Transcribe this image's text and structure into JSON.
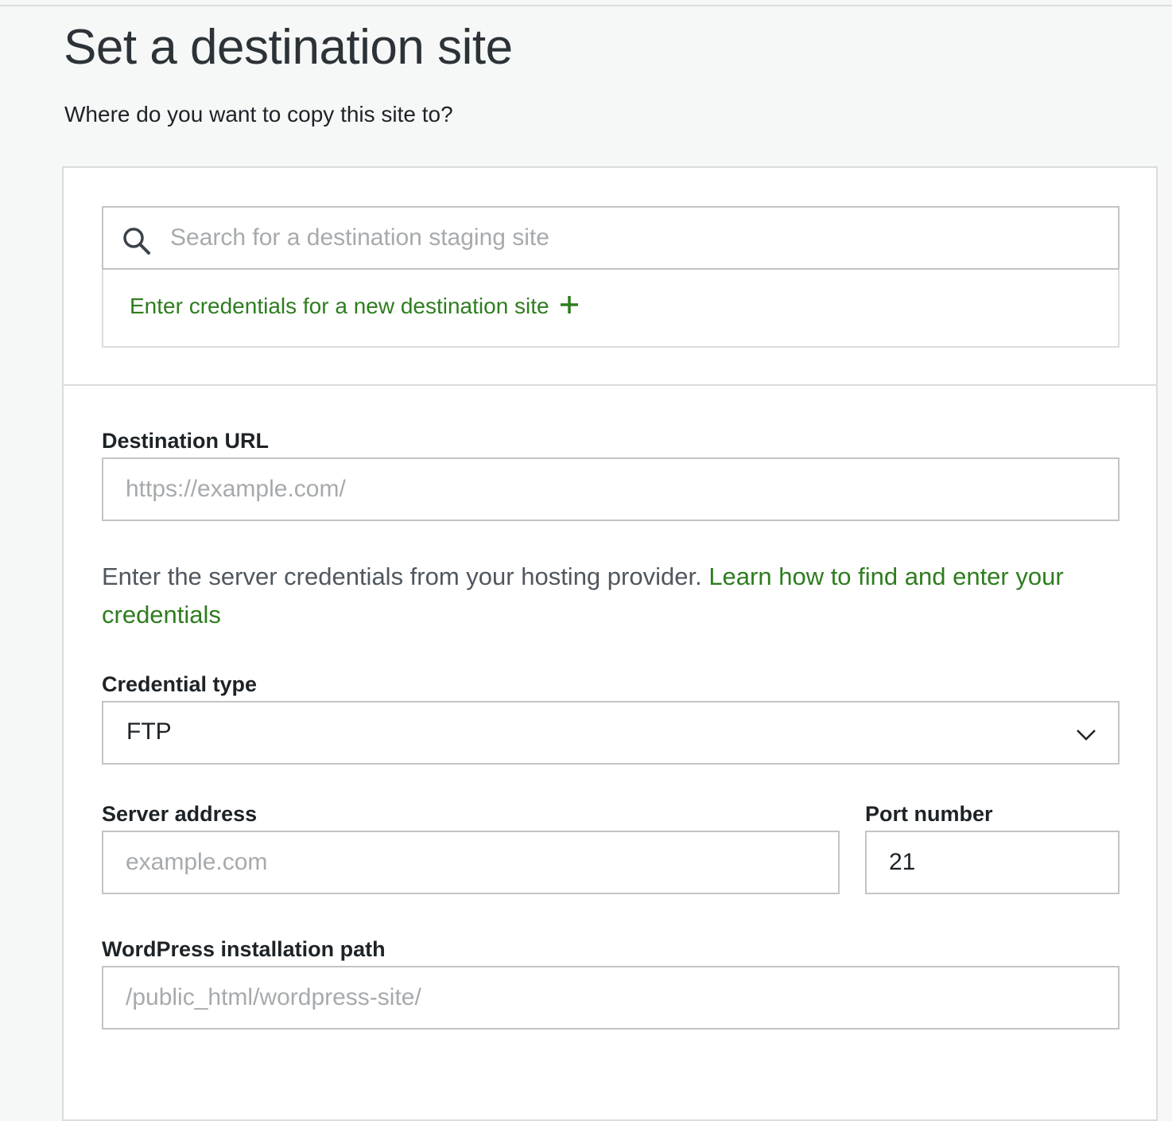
{
  "header": {
    "title": "Set a destination site",
    "subtitle": "Where do you want to copy this site to?"
  },
  "search": {
    "placeholder": "Search for a destination staging site",
    "icon": "search-icon"
  },
  "new_site": {
    "label": "Enter credentials for a new destination site",
    "icon": "plus-icon"
  },
  "form": {
    "destination_url": {
      "label": "Destination URL",
      "placeholder": "https://example.com/",
      "value": ""
    },
    "help": {
      "text": "Enter the server credentials from your hosting provider. ",
      "link": "Learn how to find and enter your credentials"
    },
    "credential_type": {
      "label": "Credential type",
      "value": "FTP",
      "icon": "chevron-down-icon"
    },
    "server_address": {
      "label": "Server address",
      "placeholder": "example.com",
      "value": ""
    },
    "port_number": {
      "label": "Port number",
      "value": "21"
    },
    "install_path": {
      "label": "WordPress installation path",
      "placeholder": "/public_html/wordpress-site/",
      "value": ""
    }
  },
  "colors": {
    "accent": "#2e7d1f",
    "border": "#c3c4c7",
    "page_bg": "#f6f7f7",
    "placeholder": "#a7aaad"
  }
}
